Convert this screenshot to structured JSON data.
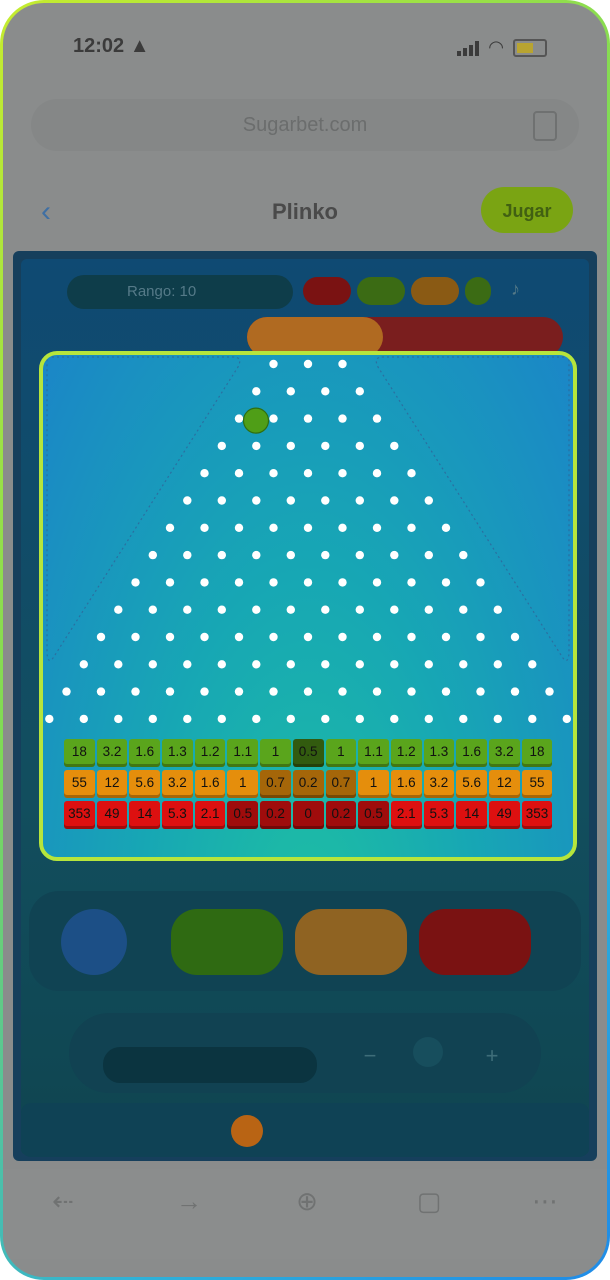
{
  "status_bar": {
    "time": "12:02 ▲"
  },
  "browser": {
    "url": "Sugarbet.com"
  },
  "header": {
    "back": "‹",
    "title": "Plinko",
    "play_label": "Jugar"
  },
  "game": {
    "top_label": "Rango: 10",
    "tabs": [
      "",
      "",
      ""
    ],
    "buttons": {
      "green": "",
      "orange": "",
      "red": ""
    },
    "bet_label": "",
    "bet_value": "",
    "strip_left": "",
    "strip_right": ""
  },
  "board": {
    "colors": {
      "border": "#b6e53c",
      "green": "#5aa51c",
      "orange": "#e58e0c",
      "red": "#dd1010",
      "ball": "#4f9e17"
    },
    "multipliers": {
      "green": [
        "18",
        "3.2",
        "1.6",
        "1.3",
        "1.2",
        "1.1",
        "1",
        "0.5",
        "1",
        "1.1",
        "1.2",
        "1.3",
        "1.6",
        "3.2",
        "18"
      ],
      "orange": [
        "55",
        "12",
        "5.6",
        "3.2",
        "1.6",
        "1",
        "0.7",
        "0.2",
        "0.7",
        "1",
        "1.6",
        "3.2",
        "5.6",
        "12",
        "55"
      ],
      "red": [
        "353",
        "49",
        "14",
        "5.3",
        "2.1",
        "0.5",
        "0.2",
        "0",
        "0.2",
        "0.5",
        "2.1",
        "5.3",
        "14",
        "49",
        "353"
      ]
    },
    "shades": {
      "green": [
        1,
        1,
        1,
        1,
        1,
        1,
        1,
        3,
        1,
        1,
        1,
        1,
        1,
        1,
        1
      ],
      "orange": [
        1,
        1,
        1,
        1,
        1,
        1,
        2,
        2,
        2,
        1,
        1,
        1,
        1,
        1,
        1
      ],
      "red": [
        1,
        1,
        1,
        1,
        1,
        2,
        2,
        2,
        2,
        2,
        1,
        1,
        1,
        1,
        1
      ]
    },
    "peg_rows": [
      3,
      4,
      5,
      6,
      7,
      8,
      9,
      10,
      11,
      12,
      13,
      14,
      15,
      16
    ],
    "ball": {
      "row": 2,
      "slot": 0
    }
  }
}
